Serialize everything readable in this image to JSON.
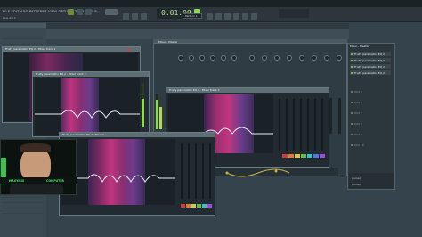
{
  "menu": {
    "items": "FILE EDIT ADD PATTERNS VIEW OPTIONS TOOLS HELP",
    "sub_label": "Line 4:1 k"
  },
  "transport": {
    "time": "0:01:08",
    "pattern": "Pattern 1"
  },
  "mixer": {
    "title": "Mixer - Master"
  },
  "plugins": [
    {
      "title": "Fruity parametric EQ 2 - Mixer track 1"
    },
    {
      "title": "Fruity parametric EQ 2 - Mixer track 2"
    },
    {
      "title": "Fruity parametric EQ 2 - Mixer track 3"
    },
    {
      "title": "Fruity parametric EQ 2 - Master"
    }
  ],
  "slots": {
    "header": "Mixer - Master",
    "items": [
      "Fruity parametric EQ 2",
      "Fruity parametric EQ 2",
      "Fruity parametric EQ 2",
      "Fruity parametric EQ 2",
      "Slot 5",
      "Slot 6",
      "Slot 7",
      "Slot 8",
      "Slot 9",
      "Slot 10"
    ],
    "footer_left": "(none)",
    "footer_right": "(none)"
  },
  "webcam": {
    "left_label": "MAXYMIX",
    "right_label": "COMPUTER"
  },
  "colors": {
    "accent_green": "#8fd94f",
    "eq_magenta": "#c0357e",
    "eq_purple": "#6b3c8c",
    "band_colors": [
      "#d33a3a",
      "#e07a2d",
      "#d6c83a",
      "#5ac34b",
      "#3ac0c8",
      "#4b7de0",
      "#a04be0",
      "#d04bb0"
    ]
  }
}
